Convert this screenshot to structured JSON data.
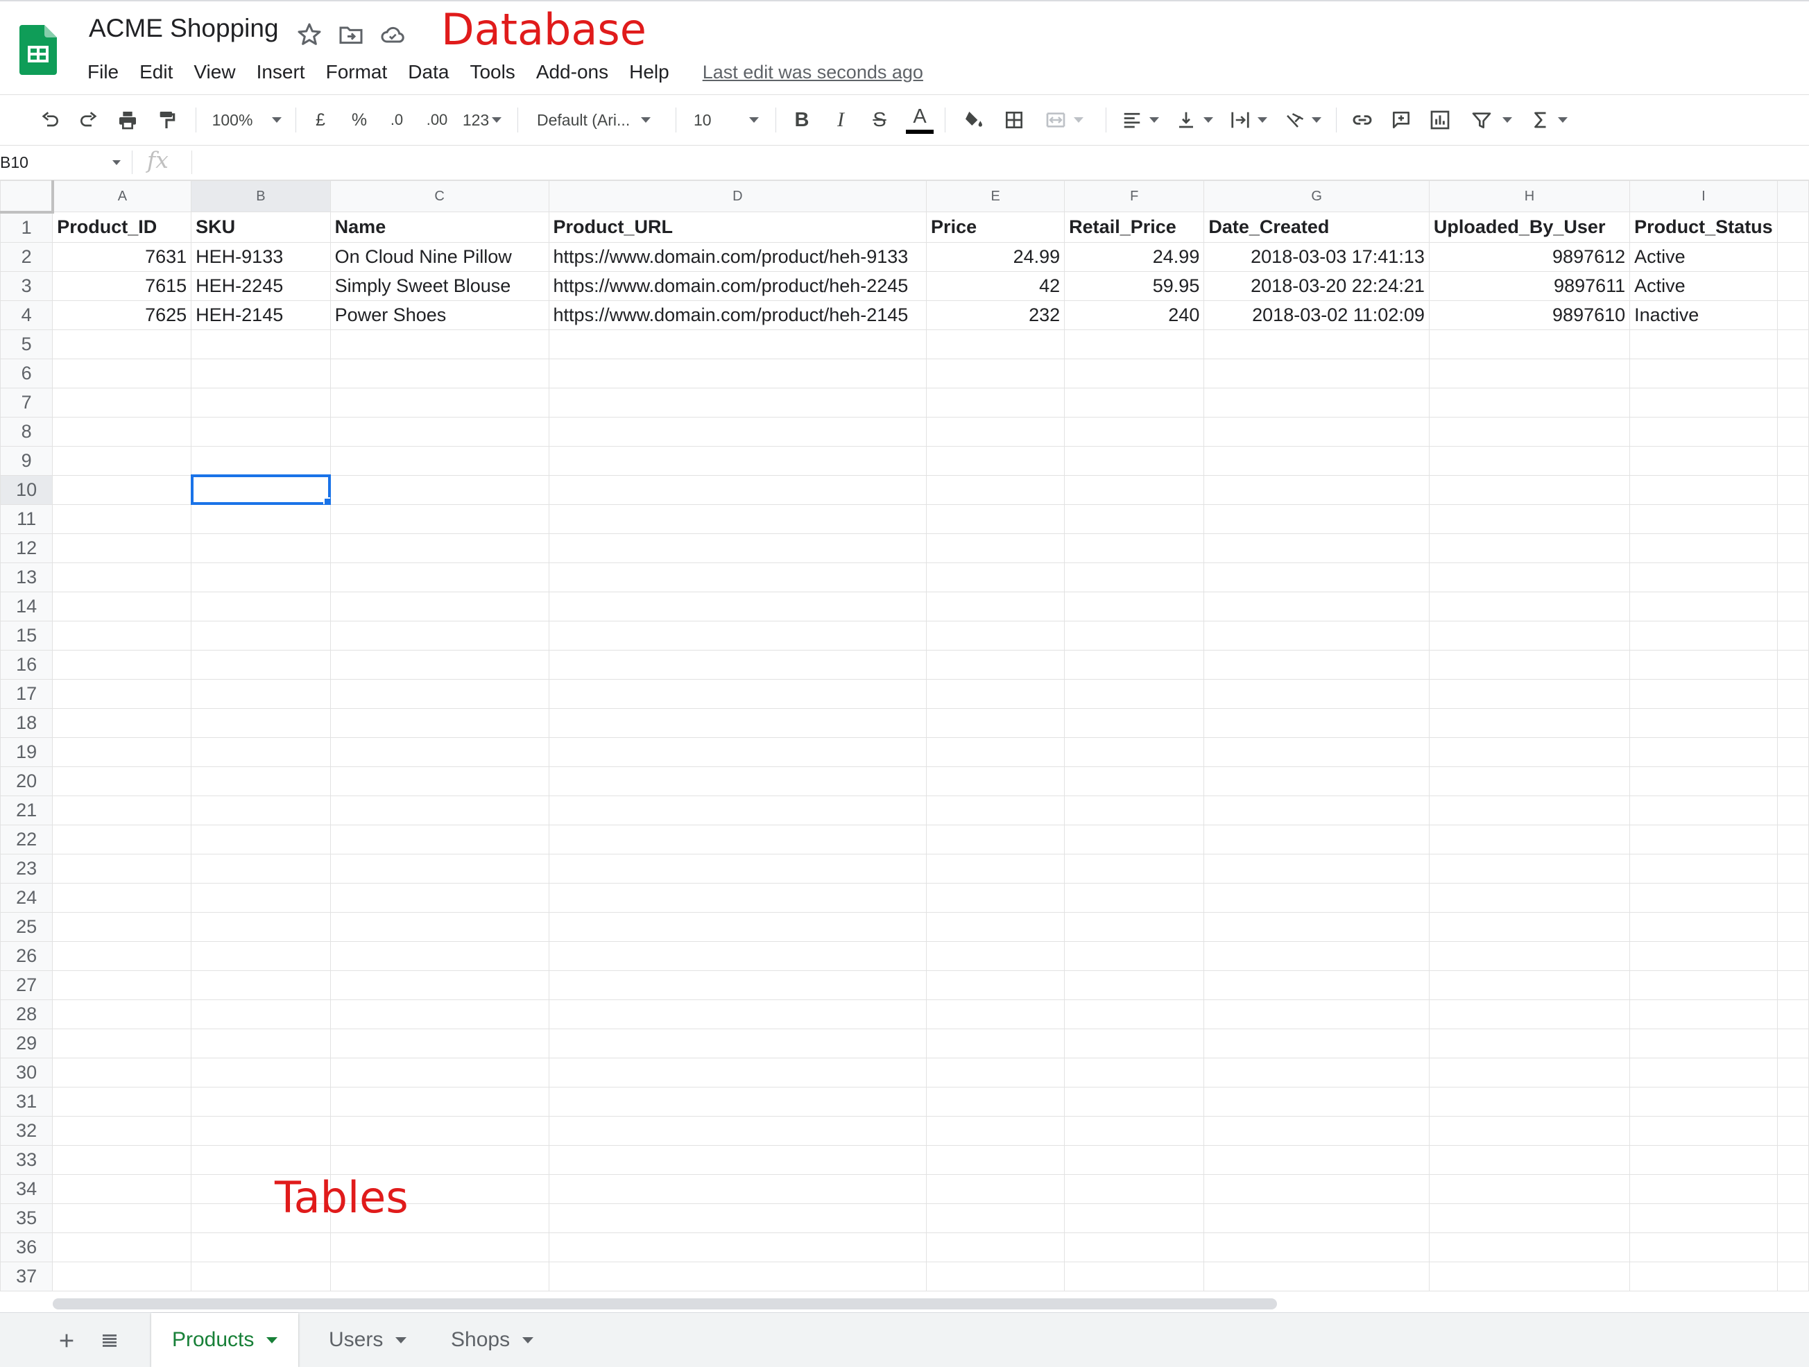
{
  "document": {
    "title": "ACME Shopping",
    "last_edit": "Last edit was seconds ago"
  },
  "annotations": {
    "top": "Database",
    "bottom": "Tables"
  },
  "menu": [
    "File",
    "Edit",
    "View",
    "Insert",
    "Format",
    "Data",
    "Tools",
    "Add-ons",
    "Help"
  ],
  "toolbar": {
    "zoom": "100%",
    "currency": "£",
    "percent": "%",
    "decrease_decimals": ".0",
    "increase_decimals": ".00",
    "more_formats": "123",
    "font_family": "Default (Ari...",
    "font_size": "10",
    "bold": "B",
    "italic": "I",
    "strikethrough": "S",
    "text_color": "A"
  },
  "formula_bar": {
    "cell_ref": "B10",
    "fx": "fx",
    "value": ""
  },
  "grid": {
    "columns": [
      "A",
      "B",
      "C",
      "D",
      "E",
      "F",
      "G",
      "H",
      "I"
    ],
    "header_row": [
      "Product_ID",
      "SKU",
      "Name",
      "Product_URL",
      "Price",
      "Retail_Price",
      "Date_Created",
      "Uploaded_By_User",
      "Product_Status"
    ],
    "rows": [
      [
        "7631",
        "HEH-9133",
        "On Cloud Nine Pillow",
        "https://www.domain.com/product/heh-9133",
        "24.99",
        "24.99",
        "2018-03-03 17:41:13",
        "9897612",
        "Active"
      ],
      [
        "7615",
        "HEH-2245",
        "Simply Sweet Blouse",
        "https://www.domain.com/product/heh-2245",
        "42",
        "59.95",
        "2018-03-20 22:24:21",
        "9897611",
        "Active"
      ],
      [
        "7625",
        "HEH-2145",
        "Power Shoes",
        "https://www.domain.com/product/heh-2145",
        "232",
        "240",
        "2018-03-02 11:02:09",
        "9897610",
        "Inactive"
      ]
    ],
    "visible_row_count": 37,
    "selected_cell": "B10"
  },
  "sheets": [
    {
      "name": "Products",
      "active": true
    },
    {
      "name": "Users",
      "active": false
    },
    {
      "name": "Shops",
      "active": false
    }
  ],
  "colors": {
    "sheets_green": "#188038",
    "selection_blue": "#1a73e8",
    "annotation_red": "#e01b1b"
  }
}
